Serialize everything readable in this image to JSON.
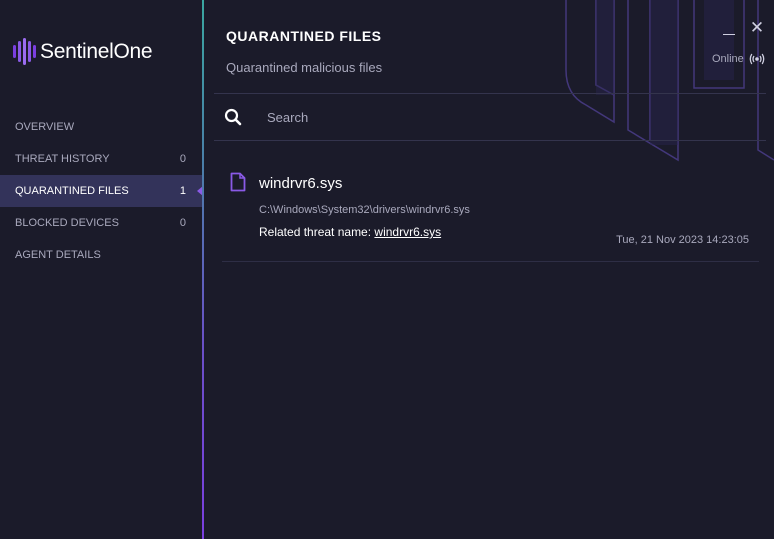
{
  "app": {
    "brand": "SentinelOne"
  },
  "sidebar": {
    "items": [
      {
        "label": "OVERVIEW",
        "count": ""
      },
      {
        "label": "THREAT HISTORY",
        "count": "0"
      },
      {
        "label": "QUARANTINED FILES",
        "count": "1"
      },
      {
        "label": "BLOCKED DEVICES",
        "count": "0"
      },
      {
        "label": "AGENT DETAILS",
        "count": ""
      }
    ]
  },
  "header": {
    "title": "QUARANTINED FILES",
    "subtitle": "Quarantined malicious files",
    "status": "Online",
    "close_glyph": "✕"
  },
  "search": {
    "placeholder": "Search"
  },
  "files": [
    {
      "name": "windrvr6.sys",
      "path": "C:\\Windows\\System32\\drivers\\windrvr6.sys",
      "threat_label": "Related threat name:",
      "threat_name": "windrvr6.sys",
      "date": "Tue, 21 Nov 2023 14:23:05"
    }
  ],
  "colors": {
    "accent": "#8a5ae6",
    "background": "#1b1b2a",
    "active_nav": "#33335a",
    "muted_text": "#a9a9bd"
  },
  "icons": {
    "logo": "sentinelone-logo-icon",
    "search": "search-icon",
    "file": "file-icon",
    "status": "broadcast-icon",
    "minimize": "minimize-icon",
    "close": "close-icon"
  }
}
